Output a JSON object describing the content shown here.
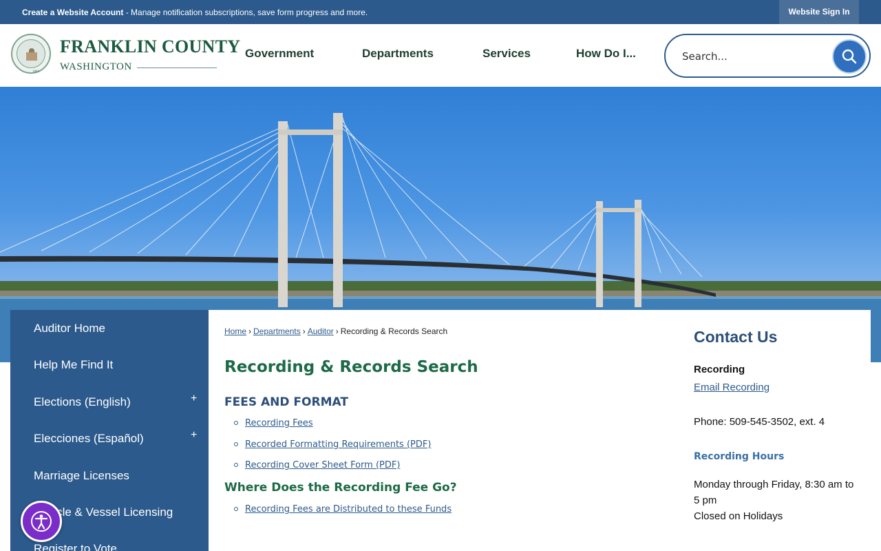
{
  "topbar": {
    "create_account": "Create a Website Account",
    "message": " - Manage notification subscriptions, save form progress and more.",
    "sign_in": "Website Sign In"
  },
  "brand": {
    "title": "FRANKLIN COUNTY",
    "subtitle": "WASHINGTON",
    "seal_year": "1883"
  },
  "nav": {
    "items": [
      "Government",
      "Departments",
      "Services",
      "How Do I..."
    ]
  },
  "search": {
    "placeholder": "Search...",
    "icon": "search-icon"
  },
  "sidebar": {
    "items": [
      {
        "label": "Auditor Home",
        "expandable": false
      },
      {
        "label": "Help Me Find It",
        "expandable": false
      },
      {
        "label": "Elections (English)",
        "expandable": true
      },
      {
        "label": "Elecciones (Español)",
        "expandable": true
      },
      {
        "label": "Marriage Licenses",
        "expandable": false
      },
      {
        "label": "Vehicle & Vessel Licensing",
        "expandable": false
      },
      {
        "label": "Register to Vote",
        "expandable": false
      }
    ],
    "expand_symbol": "+"
  },
  "breadcrumb": {
    "items": [
      "Home",
      "Departments",
      "Auditor"
    ],
    "current": "Recording & Records Search",
    "separator": "›"
  },
  "main": {
    "title": "Recording & Records Search",
    "section1": {
      "heading": "FEES AND FORMAT",
      "links": [
        "Recording Fees",
        "Recorded Formatting Requirements (PDF)",
        "Recording Cover Sheet Form (PDF)"
      ]
    },
    "section2": {
      "heading": "Where Does the Recording Fee Go?",
      "links": [
        "Recording Fees are Distributed to these Funds"
      ]
    }
  },
  "contact": {
    "title": "Contact Us",
    "label": "Recording",
    "email": "Email Recording",
    "phone": "Phone: 509-545-3502, ext. 4",
    "hours_title": "Recording Hours",
    "hours_line1": "Monday through Friday, 8:30 am to 5 pm",
    "hours_line2": "Closed on Holidays"
  },
  "colors": {
    "primary_blue": "#2c5a8c",
    "brand_green": "#1c5a40",
    "accessibility_purple": "#7a2dc8"
  },
  "accessibility": {
    "icon": "accessibility-icon"
  }
}
